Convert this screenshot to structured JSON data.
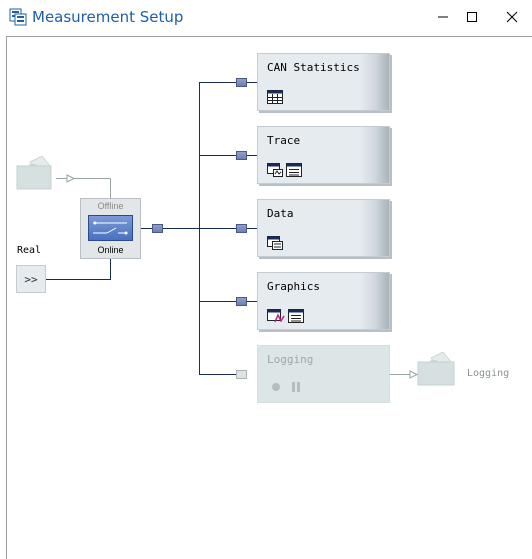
{
  "window": {
    "title": "Measurement Setup",
    "title_color": "#1f5fa8",
    "controls": [
      "minimize-icon",
      "maximize-icon",
      "close-icon"
    ]
  },
  "switch": {
    "offline_label": "Offline",
    "online_label": "Online",
    "state": "Online"
  },
  "real": {
    "label": "Real",
    "button_label": ">>"
  },
  "blocks": [
    {
      "label": "CAN Statistics",
      "icons": [
        "statistics-table-icon"
      ],
      "enabled": true
    },
    {
      "label": "Trace",
      "icons": [
        "trace-window-icon",
        "config-icon"
      ],
      "enabled": true
    },
    {
      "label": "Data",
      "icons": [
        "data-window-icon"
      ],
      "enabled": true
    },
    {
      "label": "Graphics",
      "icons": [
        "graphics-window-icon",
        "config-icon"
      ],
      "enabled": true
    },
    {
      "label": "Logging",
      "icons": [
        "record-icon",
        "pause-icon"
      ],
      "enabled": false
    }
  ],
  "logging_output": {
    "label": "Logging"
  },
  "colors": {
    "wire": "#1a2a5a",
    "node": "#6f80b0",
    "block_bg": "#e6ebef",
    "disabled_block_bg": "#dde6e6"
  }
}
